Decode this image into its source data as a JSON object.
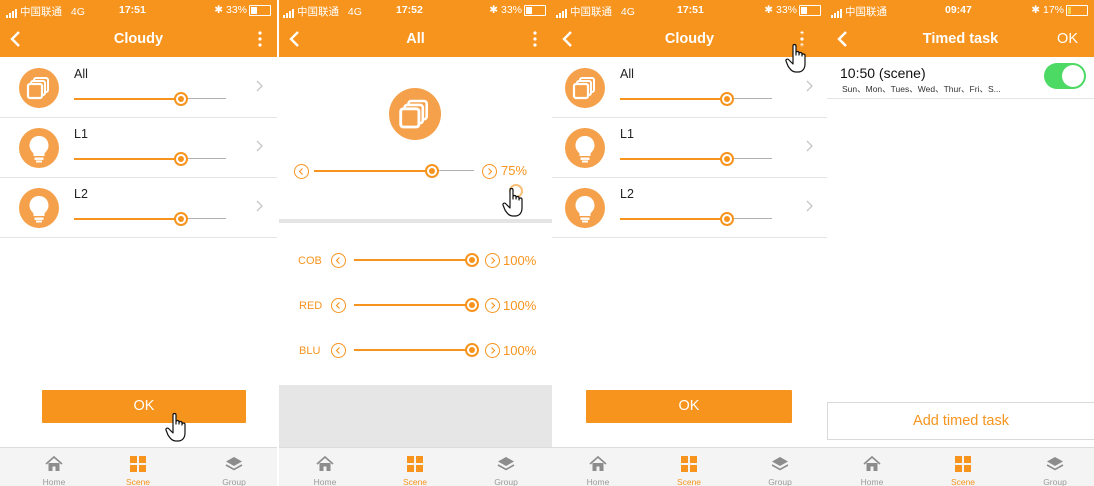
{
  "colors": {
    "accent": "#f7941d",
    "toggle_on": "#4cd964"
  },
  "screens": [
    {
      "status": {
        "carrier": "中国联通",
        "network": "4G",
        "time": "17:51",
        "battery": "33%"
      },
      "nav": {
        "title": "Cloudy"
      },
      "rows": [
        {
          "label": "All",
          "icon": "layers-icon",
          "value": 0.68
        },
        {
          "label": "L1",
          "icon": "bulb-icon",
          "value": 0.68
        },
        {
          "label": "L2",
          "icon": "bulb-icon",
          "value": 0.68
        }
      ],
      "ok_label": "OK"
    },
    {
      "status": {
        "carrier": "中国联通",
        "network": "4G",
        "time": "17:52",
        "battery": "33%"
      },
      "nav": {
        "title": "All"
      },
      "master": {
        "value": 0.75,
        "percent": "75%"
      },
      "channels": [
        {
          "label": "COB",
          "value": 1.0,
          "percent": "100%"
        },
        {
          "label": "RED",
          "value": 1.0,
          "percent": "100%"
        },
        {
          "label": "BLU",
          "value": 1.0,
          "percent": "100%"
        }
      ]
    },
    {
      "status": {
        "carrier": "中国联通",
        "network": "4G",
        "time": "17:51",
        "battery": "33%"
      },
      "nav": {
        "title": "Cloudy"
      },
      "rows": [
        {
          "label": "All",
          "icon": "layers-icon",
          "value": 0.68
        },
        {
          "label": "L1",
          "icon": "bulb-icon",
          "value": 0.68
        },
        {
          "label": "L2",
          "icon": "bulb-icon",
          "value": 0.68
        }
      ],
      "ok_label": "OK"
    },
    {
      "status": {
        "carrier": "中国联通",
        "network": "",
        "time": "09:47",
        "battery": "17%"
      },
      "nav": {
        "title": "Timed task",
        "right": "OK"
      },
      "task": {
        "time": "10:50  (scene)",
        "days": "Sun、Mon、Tues、Wed、Thur、Fri、S...",
        "enabled": true
      },
      "add_label": "Add timed task"
    }
  ],
  "tabs": [
    {
      "label": "Home",
      "icon": "home-icon"
    },
    {
      "label": "Scene",
      "icon": "scene-icon"
    },
    {
      "label": "Group",
      "icon": "group-icon"
    }
  ]
}
